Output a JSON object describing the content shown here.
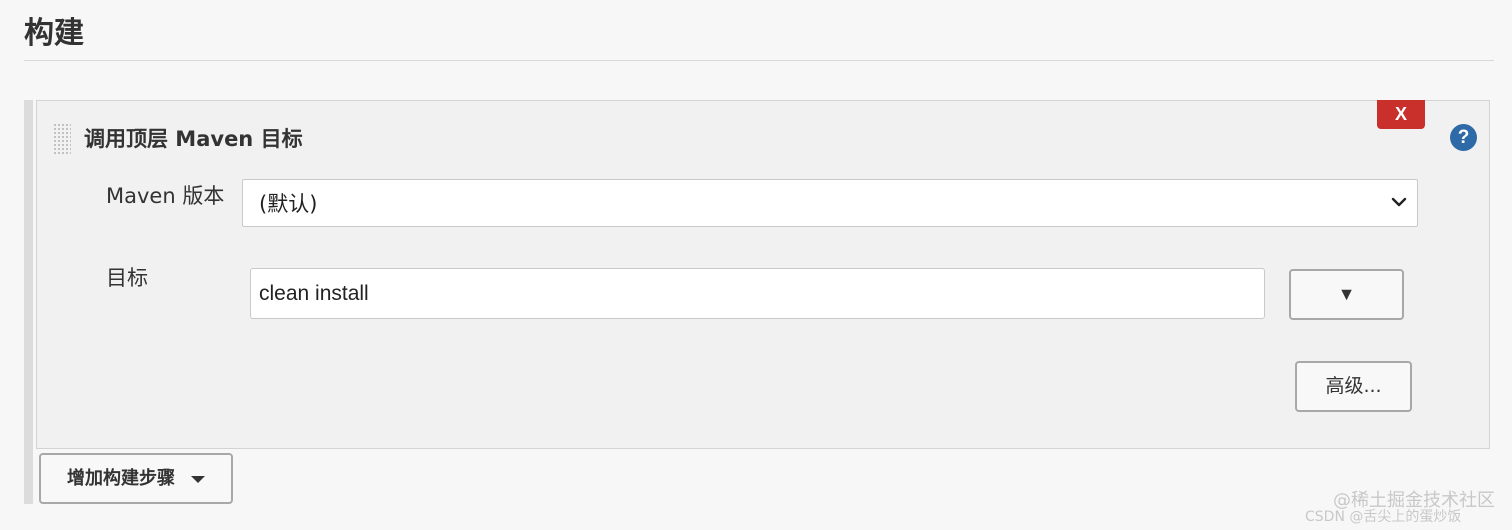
{
  "section": {
    "title": "构建"
  },
  "build_step": {
    "title": "调用顶层 Maven 目标",
    "delete_label": "X",
    "help_label": "?",
    "maven_version": {
      "label": "Maven 版本",
      "selected": "(默认)",
      "icon": "chevron-down-icon"
    },
    "goals": {
      "label": "目标",
      "value": "clean install",
      "expand_label": "▼"
    },
    "advanced_label": "高级..."
  },
  "add_step": {
    "label": "增加构建步骤",
    "icon": "caret-down-icon"
  },
  "watermark": {
    "line1": "@稀土掘金技术社区",
    "line2": "CSDN @舌尖上的蛋炒饭"
  },
  "colors": {
    "delete": "#c9302c",
    "help": "#2e6aa8",
    "panel": "#f1f1f1",
    "page": "#f7f7f7"
  }
}
